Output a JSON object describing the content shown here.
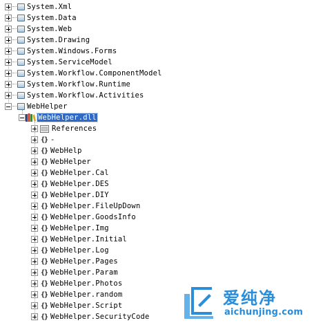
{
  "tree": {
    "top_items": [
      {
        "label": "System.Xml"
      },
      {
        "label": "System.Data"
      },
      {
        "label": "System.Web"
      },
      {
        "label": "System.Drawing"
      },
      {
        "label": "System.Windows.Forms"
      },
      {
        "label": "System.ServiceModel"
      },
      {
        "label": "System.Workflow.ComponentModel"
      },
      {
        "label": "System.Workflow.Runtime"
      },
      {
        "label": "System.Workflow.Activities"
      },
      {
        "label": "WebHelper"
      }
    ],
    "assembly": {
      "label": "WebHelper.dll"
    },
    "references": {
      "label": "References"
    },
    "namespaces": [
      {
        "label": "-"
      },
      {
        "label": "WebHelp"
      },
      {
        "label": "WebHelper"
      },
      {
        "label": "WebHelper.Cal"
      },
      {
        "label": "WebHelper.DES"
      },
      {
        "label": "WebHelper.DIY"
      },
      {
        "label": "WebHelper.FileUpDown"
      },
      {
        "label": "WebHelper.GoodsInfo"
      },
      {
        "label": "WebHelper.Img"
      },
      {
        "label": "WebHelper.Initial"
      },
      {
        "label": "WebHelper.Log"
      },
      {
        "label": "WebHelper.Pages"
      },
      {
        "label": "WebHelper.Param"
      },
      {
        "label": "WebHelper.Photos"
      },
      {
        "label": "WebHelper.random"
      },
      {
        "label": "WebHelper.Script"
      },
      {
        "label": "WebHelper.SecurityCode"
      }
    ],
    "namespace_glyph": "{}"
  },
  "watermark": {
    "site_cn": "爱纯净",
    "site_url": "aichunjing.com"
  },
  "icons": {
    "expander": "plus-box-icon",
    "collapser": "minus-box-icon",
    "reference": "assembly-reference-icon",
    "assembly": "assembly-books-icon",
    "namespace": "namespace-braces-icon"
  },
  "colors": {
    "selection": "#316ac5",
    "brand_blue": "#2a8bd6"
  }
}
